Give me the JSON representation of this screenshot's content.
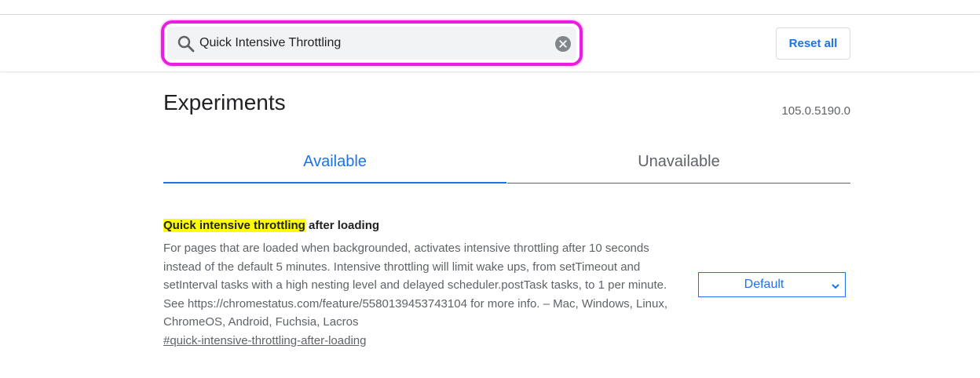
{
  "search": {
    "value": "Quick Intensive Throttling",
    "highlight_color": "#e91ee0"
  },
  "header": {
    "reset_label": "Reset all"
  },
  "page": {
    "title": "Experiments",
    "version": "105.0.5190.0"
  },
  "tabs": [
    {
      "label": "Available",
      "active": true
    },
    {
      "label": "Unavailable",
      "active": false
    }
  ],
  "experiment": {
    "title_highlighted": "Quick intensive throttling",
    "title_rest": " after loading",
    "description": "For pages that are loaded when backgrounded, activates intensive throttling after 10 seconds instead of the default 5 minutes. Intensive throttling will limit wake ups, from setTimeout and setInterval tasks with a high nesting level and delayed scheduler.postTask tasks, to 1 per minute. See https://chromestatus.com/feature/5580139453743104 for more info. – Mac, Windows, Linux, ChromeOS, Android, Fuchsia, Lacros",
    "link": "#quick-intensive-throttling-after-loading",
    "select_value": "Default"
  },
  "icons": {
    "search": "search-icon",
    "clear": "clear-icon",
    "chevron": "chevron-down-icon"
  },
  "colors": {
    "accent": "#1a73e8",
    "match_highlight": "#ffff00"
  }
}
